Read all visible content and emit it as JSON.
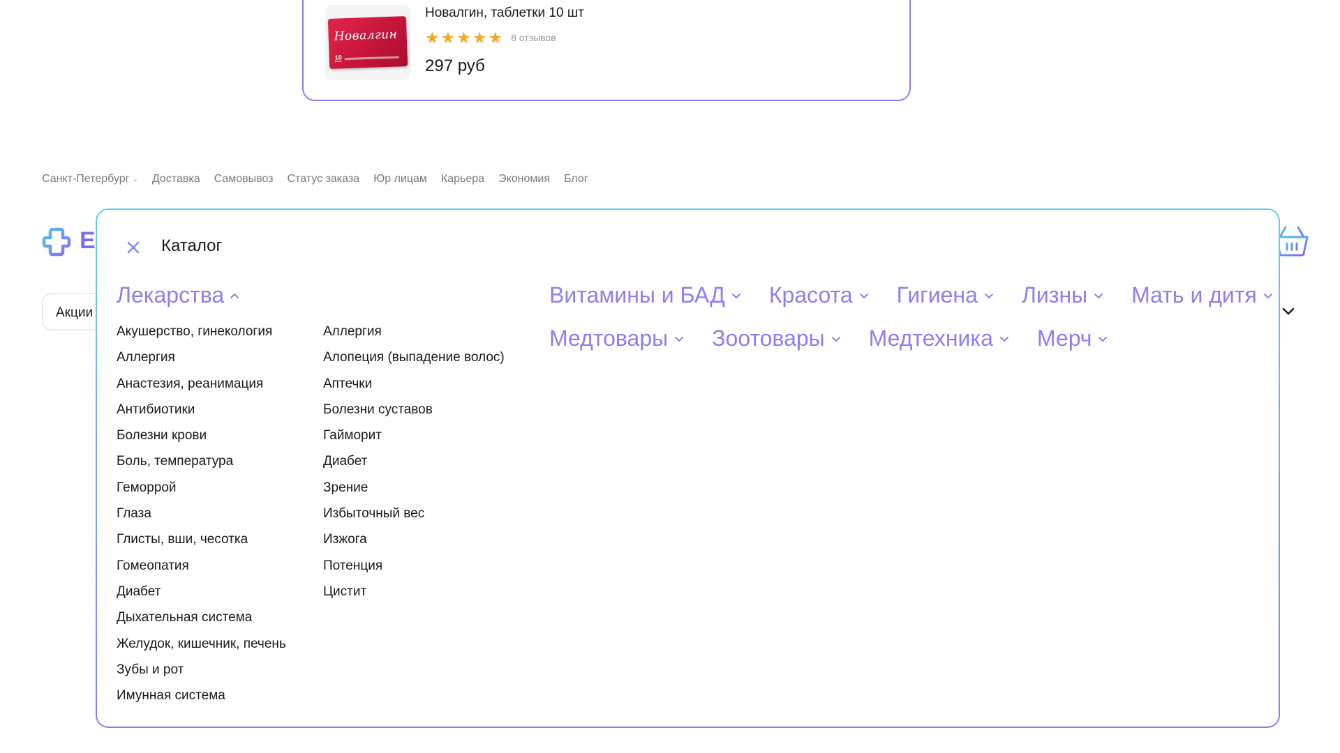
{
  "colors": {
    "accent": "#8c7ff2",
    "star": "#f5a623",
    "border_top": "#5fd0f2",
    "border_bottom": "#8a7cf2"
  },
  "product": {
    "name": "Новалгин, таблетки 10 шт",
    "box_logo": "Новалгин",
    "box_number": "10",
    "rating": 5,
    "stars": [
      "★",
      "★",
      "★",
      "★",
      "★"
    ],
    "reviews": "8 отзывов",
    "price": "297 руб"
  },
  "top_links": {
    "city": "Санкт-Петербург",
    "items": [
      "Доставка",
      "Самовывоз",
      "Статус заказа",
      "Юр лицам",
      "Карьера",
      "Экономия",
      "Блог"
    ]
  },
  "header": {
    "brand_letter": "Е",
    "promo_label": "Акции"
  },
  "catalog": {
    "title": "Каталог",
    "active_category": "Лекарства",
    "subcategories_col1": [
      "Акушерство, гинекология",
      "Аллергия",
      "Анастезия, реанимация",
      "Антибиотики",
      "Болезни крови",
      "Боль, температура",
      "Геморрой",
      "Глаза",
      "Глисты, вши, чесотка",
      "Гомеопатия",
      "Диабет",
      "Дыхательная система",
      "Желудок, кишечник, печень",
      "Зубы и рот",
      "Имунная система"
    ],
    "subcategories_col2": [
      "Аллергия",
      "Алопеция (выпадение волос)",
      "Аптечки",
      "Болезни суставов",
      "Гайморит",
      "Диабет",
      "Зрение",
      "Избыточный вес",
      "Изжога",
      "Потенция",
      "Цистит"
    ],
    "categories_row1": [
      "Витамины и БАД",
      "Красота",
      "Гигиена",
      "Лизны",
      "Мать и дитя"
    ],
    "categories_row2": [
      "Медтовары",
      "Зоотовары",
      "Медтехника",
      "Мерч"
    ]
  }
}
